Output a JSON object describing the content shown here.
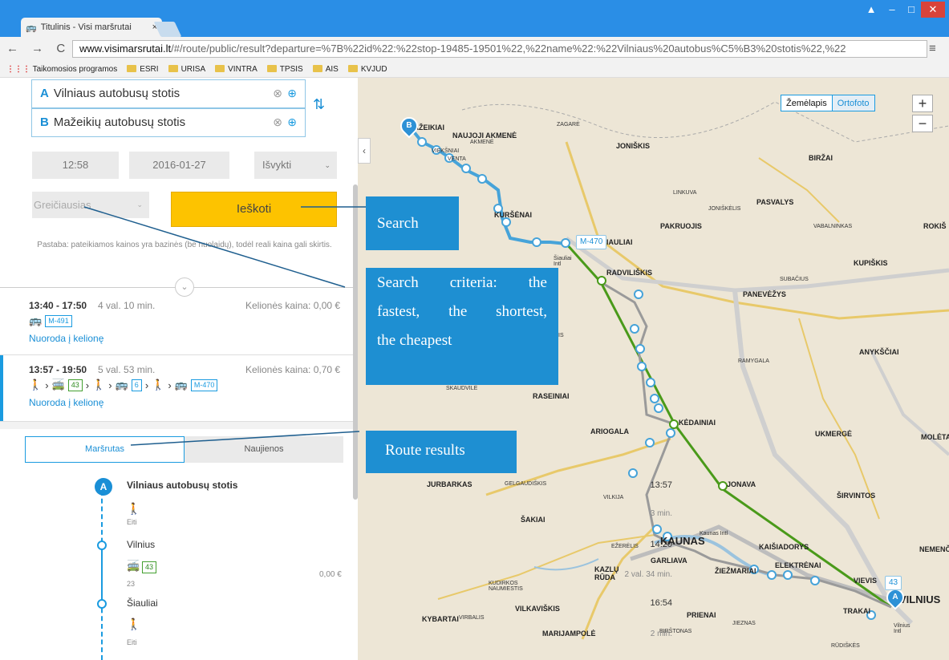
{
  "browser": {
    "tab_title": "Titulinis - Visi maršrutai",
    "tab_close": "×",
    "url_host": "www.visimarsrutai.lt",
    "url_rest": "/#/route/public/result?departure=%7B%22id%22:%22stop-19485-19501%22,%22name%22:%22Vilniaus%20autobus%C5%B3%20stotis%22,%22",
    "win_user": "▲",
    "win_min": "–",
    "win_max": "□",
    "win_close": "✕",
    "nav": "← → C",
    "menu": "≡",
    "bookmarks": [
      "Taikomosios programos",
      "ESRI",
      "URISA",
      "VINTRA",
      "TPSIS",
      "AIS",
      "KVJUD"
    ]
  },
  "search": {
    "from_letter": "A",
    "from": "Vilniaus autobusų stotis",
    "to_letter": "B",
    "to": "Mažeikių autobusų stotis",
    "time": "12:58",
    "date": "2016-01-27",
    "mode": "Išvykti",
    "criteria": "Greičiausias",
    "button": "Ieškoti",
    "note": "Pastaba: pateikiamos kainos yra bazinės (be nuolaidų), todėl reali kaina gali skirtis."
  },
  "results": [
    {
      "time": "13:40 - 17:50",
      "duration": "4 val. 10 min.",
      "price": "Kelionės kaina: 0,00 €",
      "badges": [
        "M-491"
      ],
      "link": "Nuoroda į kelionę"
    },
    {
      "time": "13:57 - 19:50",
      "duration": "5 val. 53 min.",
      "price": "Kelionės kaina: 0,70 €",
      "badges": [
        "43",
        "6",
        "M-470"
      ],
      "link": "Nuoroda į kelionę"
    }
  ],
  "details": {
    "tab_route": "Maršrutas",
    "tab_news": "Naujienos",
    "pin_letter": "A",
    "rows": [
      {
        "time": "13:57",
        "name": "Vilniaus autobusų stotis"
      },
      {
        "dur": "3 min.",
        "sub": "Eiti"
      },
      {
        "time": "14:20",
        "name": "Vilnius"
      },
      {
        "dur": "2 val. 34 min.",
        "badge": "43",
        "sub": "23",
        "price": "0,00 €"
      },
      {
        "time": "16:54",
        "name": "Šiauliai"
      },
      {
        "dur": "2 min.",
        "sub": "Eiti"
      }
    ]
  },
  "map": {
    "type_map": "Žemėlapis",
    "type_ortho": "Ortofoto",
    "zoom_in": "+",
    "zoom_out": "−",
    "collapse": "‹",
    "badge_m470": "M-470",
    "badge_43": "43",
    "pin_b": "B",
    "pin_a": "A",
    "cities": [
      "MAŽEIKIAI",
      "NAUJOJI AKMENĖ",
      "JONIŠKIS",
      "BIRŽAI",
      "KURŠĖNAI",
      "PAKRUOJIS",
      "PASVALYS",
      "ROKIŠ",
      "KUPIŠKIS",
      "RADVILIŠKIS",
      "PANEVĖŽYS",
      "ANYKŠČIAI",
      "RASEINIAI",
      "KĖDAINIAI",
      "UKMERGĖ",
      "MOLĖTA",
      "ARIOGALA",
      "JURBARKAS",
      "JONAVA",
      "ŠIRVINTOS",
      "ŠAKIAI",
      "KAUNAS",
      "KAIŠIADORYS",
      "NEMENČ",
      "GARLIAVA",
      "KAZLŲ RŪDA",
      "ŽIEŽMARIAI",
      "ELEKTRĖNAI",
      "VIEVIS",
      "VILNIUS",
      "KYBARTAI",
      "VILKAVIŠKIS",
      "PRIENAI",
      "TRAKAI",
      "MARIJAMPOLĖ",
      "ŠIAULIAI"
    ],
    "small": [
      "ZAGARĖ",
      "AKMENĖ",
      "VIEKŠNIAI",
      "VENTA",
      "LINKUVA",
      "JONIŠKĖLIS",
      "VABALNINKAS",
      "SUBAČIUS",
      "RAMYGALA",
      "UŽVENTIS",
      "SKAUDVILĖ",
      "GELGAUDIŠKIS",
      "VILKIJA",
      "EŽERĖLIS",
      "KUDIRKOS NAUMIESTIS",
      "VIRBALIS",
      "BIRŠTONAS",
      "JIEZNAS",
      "RŪDIŠKĖS",
      "Šiauliai Intl",
      "Kaunas Intl",
      "Vilnius Intl"
    ]
  },
  "callouts": {
    "search": "Search",
    "criteria_1": "Search criteria: the",
    "criteria_2": "fastest, the shortest,",
    "criteria_3": "the cheapest",
    "route": "Route results"
  },
  "colors": {
    "accent": "#1a9be0",
    "search_button": "#fdc300",
    "route_green": "#4a9a1a",
    "callout": "#1e8fd2"
  }
}
